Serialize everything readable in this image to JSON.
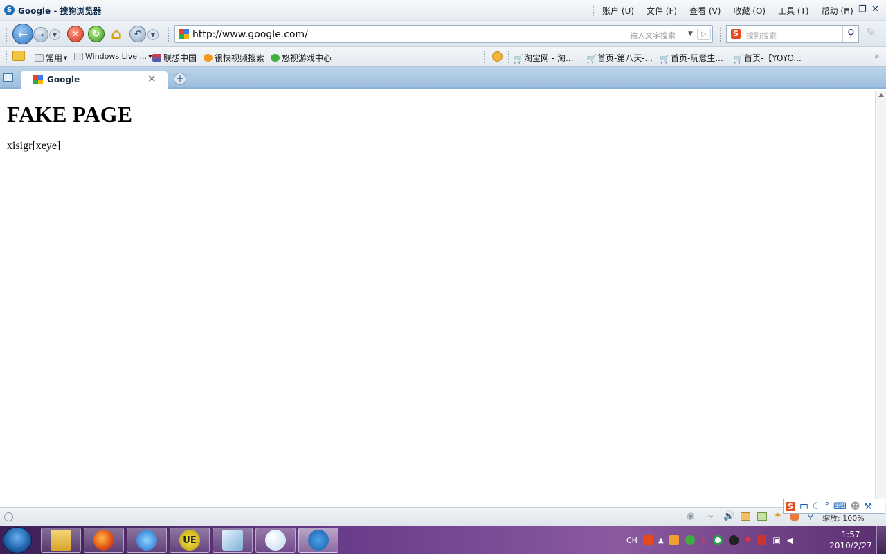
{
  "window": {
    "title": "Google - 搜狗浏览器",
    "menu": [
      "账户 (U)",
      "文件 (F)",
      "查看 (V)",
      "收藏 (O)",
      "工具 (T)",
      "帮助 (H)"
    ]
  },
  "address": {
    "url": "http://www.google.com/",
    "search_hint": "输入文字搜索"
  },
  "search": {
    "placeholder": "搜狗搜索"
  },
  "bookmarks": {
    "left": [
      "常用",
      "Windows Live ...",
      "联想中国",
      "很快视频搜索",
      "悠视游戏中心"
    ],
    "right": [
      "淘宝网 - 淘...",
      "首页-第八天-...",
      "首页-玩意生...",
      "首页-【YOYO..."
    ]
  },
  "tab": {
    "title": "Google"
  },
  "page": {
    "heading": "FAKE PAGE",
    "text": "xisigr[xeye]"
  },
  "statusbar": {
    "zoom": "缩放: 100%"
  },
  "ime": {
    "items": [
      "中"
    ]
  },
  "taskbar": {
    "lang": "CH",
    "time": "1:57",
    "date": "2010/2/27"
  },
  "colors": {
    "tab_bar": "#9fbfdd",
    "taskbar": "#6a3d8a"
  },
  "icons": [
    "back-icon",
    "forward-icon",
    "stop-icon",
    "refresh-icon",
    "home-icon",
    "undo-icon",
    "google-favicon",
    "search-icon",
    "close-icon",
    "new-tab-icon"
  ]
}
